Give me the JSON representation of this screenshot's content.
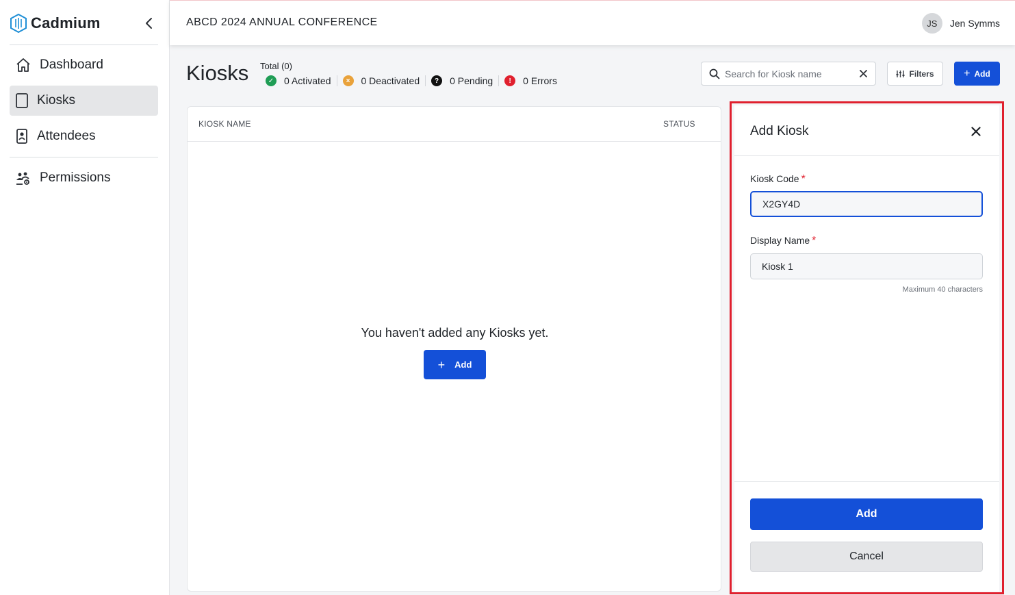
{
  "brand": {
    "name": "Cadmium"
  },
  "sidebar": {
    "items": [
      {
        "label": "Dashboard",
        "icon": "home-icon"
      },
      {
        "label": "Kiosks",
        "icon": "tablet-icon",
        "active": true
      },
      {
        "label": "Attendees",
        "icon": "badge-icon"
      },
      {
        "label": "Permissions",
        "icon": "users-gear-icon"
      }
    ]
  },
  "header": {
    "event_title": "ABCD 2024 ANNUAL CONFERENCE",
    "user": {
      "initials": "JS",
      "name": "Jen Symms"
    }
  },
  "page": {
    "title": "Kiosks",
    "total": "Total (0)",
    "stats": [
      {
        "label": "0 Activated",
        "color": "#1f9d55",
        "symbol": "✓"
      },
      {
        "label": "0 Deactivated",
        "color": "#e9a23b",
        "symbol": "×"
      },
      {
        "label": "0 Pending",
        "color": "#111111",
        "symbol": "?"
      },
      {
        "label": "0 Errors",
        "color": "#e0202e",
        "symbol": "!"
      }
    ]
  },
  "toolbar": {
    "search_placeholder": "Search for Kiosk name",
    "filters_label": "Filters",
    "add_label": "Add"
  },
  "table": {
    "columns": [
      "KIOSK NAME",
      "STATUS"
    ],
    "empty_message": "You haven't added any Kiosks yet.",
    "empty_add_label": "Add"
  },
  "drawer": {
    "title": "Add Kiosk",
    "kiosk_code": {
      "label": "Kiosk Code",
      "value": "X2GY4D"
    },
    "display_name": {
      "label": "Display Name",
      "value": "Kiosk 1",
      "hint": "Maximum 40 characters"
    },
    "add_label": "Add",
    "cancel_label": "Cancel"
  },
  "colors": {
    "primary": "#1450d8",
    "required": "#e0202e",
    "highlight_outline": "#e0202e"
  }
}
